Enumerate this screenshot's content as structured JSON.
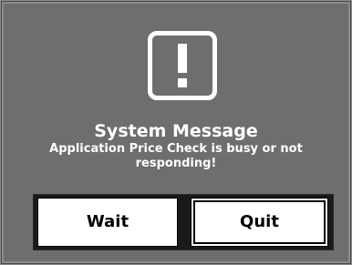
{
  "dialog": {
    "icon": "exclamation-icon",
    "title": "System Message",
    "message": "Application Price Check is busy or not responding!",
    "buttons": {
      "wait_label": "Wait",
      "quit_label": "Quit"
    }
  },
  "colors": {
    "dialog_background": "#6e6e6e",
    "text": "#ffffff",
    "button_background": "#ffffff",
    "button_text": "#000000"
  }
}
